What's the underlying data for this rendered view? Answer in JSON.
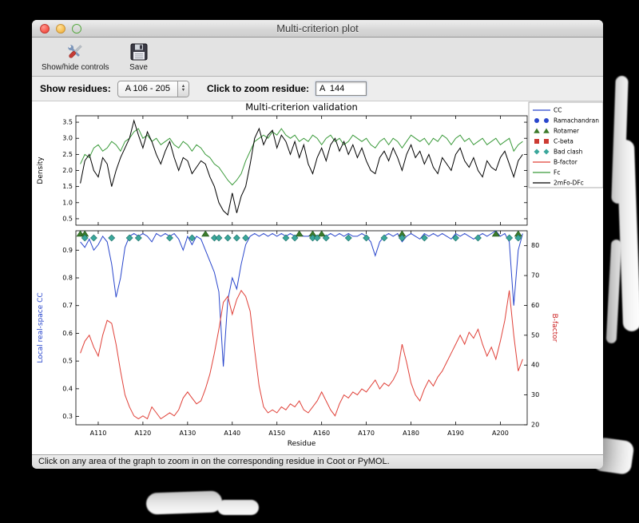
{
  "window": {
    "title": "Multi-criterion plot"
  },
  "toolbar": {
    "show_hide_label": "Show/hide controls",
    "save_label": "Save"
  },
  "controls": {
    "show_residues_label": "Show residues:",
    "residue_range_value": "A 106 - 205",
    "zoom_residue_label": "Click to zoom residue:",
    "zoom_residue_value": "A  144"
  },
  "status": {
    "text": "Click on any area of the graph to zoom in on the corresponding residue in Coot or PyMOL."
  },
  "chart_data": {
    "type": "line",
    "title": "Multi-criterion validation",
    "xlabel": "Residue",
    "x_start": 106,
    "xlim": [
      105,
      206
    ],
    "xticks": [
      110,
      120,
      130,
      140,
      150,
      160,
      170,
      180,
      190,
      200
    ],
    "xtick_labels": [
      "A110",
      "A120",
      "A130",
      "A140",
      "A150",
      "A160",
      "A170",
      "A180",
      "A190",
      "A200"
    ],
    "legend": [
      {
        "label": "CC",
        "type": "line",
        "color": "#2946cc"
      },
      {
        "label": "Ramachandran",
        "type": "circles",
        "color": "#2946cc"
      },
      {
        "label": "Rotamer",
        "type": "triangles",
        "color": "#3b7a2a"
      },
      {
        "label": "C-beta",
        "type": "squares",
        "color": "#cc3b33"
      },
      {
        "label": "Bad clash",
        "type": "diamonds",
        "color": "#3aa79b"
      },
      {
        "label": "B-factor",
        "type": "line",
        "color": "#e04038"
      },
      {
        "label": "Fc",
        "type": "line",
        "color": "#3a9a3a"
      },
      {
        "label": "2mFo-DFc",
        "type": "line",
        "color": "#000000"
      }
    ],
    "top": {
      "ylabel": "Density",
      "ylim": [
        0.3,
        3.7
      ],
      "yticks": [
        0.5,
        1.0,
        1.5,
        2.0,
        2.5,
        3.0,
        3.5
      ],
      "series": [
        {
          "name": "Fc",
          "color": "#3a9a3a",
          "values": [
            2.2,
            2.5,
            2.4,
            2.7,
            2.8,
            2.6,
            2.7,
            2.9,
            2.8,
            2.6,
            2.9,
            3.0,
            3.2,
            3.3,
            3.0,
            3.1,
            2.9,
            3.0,
            2.8,
            2.9,
            3.0,
            2.8,
            2.7,
            2.9,
            2.8,
            2.6,
            2.8,
            2.7,
            2.5,
            2.4,
            2.2,
            2.1,
            1.9,
            1.7,
            1.55,
            1.7,
            1.9,
            2.3,
            2.6,
            2.9,
            3.0,
            3.1,
            3.0,
            3.2,
            3.1,
            3.3,
            3.1,
            3.0,
            3.1,
            2.9,
            3.0,
            2.9,
            3.1,
            3.0,
            2.8,
            3.0,
            3.1,
            2.9,
            3.0,
            2.8,
            2.9,
            3.1,
            3.0,
            2.9,
            3.0,
            2.8,
            2.7,
            2.9,
            3.0,
            2.8,
            3.0,
            2.9,
            2.7,
            2.9,
            3.1,
            3.0,
            2.9,
            3.0,
            2.8,
            3.0,
            2.9,
            3.1,
            3.0,
            2.8,
            3.0,
            3.1,
            2.9,
            3.0,
            2.8,
            2.9,
            3.0,
            2.8,
            2.9,
            3.0,
            2.8,
            2.9,
            3.0,
            2.6,
            2.8,
            2.9
          ]
        },
        {
          "name": "2mFo-DFc",
          "color": "#000000",
          "values": [
            1.6,
            2.3,
            2.5,
            2.0,
            1.8,
            2.4,
            2.2,
            1.5,
            2.0,
            2.4,
            2.7,
            3.0,
            3.55,
            3.1,
            2.7,
            3.2,
            2.9,
            2.5,
            2.2,
            2.6,
            2.9,
            2.4,
            2.0,
            2.4,
            2.3,
            1.9,
            2.1,
            2.3,
            2.2,
            1.8,
            1.5,
            1.0,
            0.75,
            0.62,
            1.3,
            0.68,
            1.2,
            1.5,
            2.2,
            3.0,
            3.3,
            2.8,
            3.1,
            3.25,
            2.7,
            3.1,
            2.9,
            2.5,
            2.9,
            2.4,
            2.8,
            2.2,
            1.9,
            2.4,
            2.7,
            2.3,
            2.8,
            3.0,
            2.6,
            2.9,
            2.5,
            2.8,
            2.4,
            2.7,
            2.3,
            2.0,
            1.9,
            2.4,
            2.6,
            2.3,
            2.7,
            2.4,
            2.0,
            2.5,
            2.8,
            2.4,
            2.6,
            2.2,
            2.5,
            2.1,
            1.9,
            2.4,
            2.2,
            2.0,
            2.5,
            2.7,
            2.3,
            2.1,
            2.4,
            2.0,
            1.8,
            2.3,
            2.1,
            2.0,
            2.4,
            2.6,
            2.2,
            1.8,
            2.3,
            2.5
          ]
        }
      ]
    },
    "bottom": {
      "ylabel_left": "Local real-space CC",
      "ylabel_left_color": "#2946cc",
      "ylim_left": [
        0.27,
        0.97
      ],
      "yticks_left": [
        0.3,
        0.4,
        0.5,
        0.6,
        0.7,
        0.8,
        0.9
      ],
      "ylabel_right": "B-factor",
      "ylabel_right_color": "#cc2222",
      "ylim_right": [
        20,
        85
      ],
      "yticks_right": [
        20,
        30,
        40,
        50,
        60,
        70,
        80
      ],
      "series": [
        {
          "name": "CC",
          "axis": "left",
          "color": "#2946cc",
          "values": [
            0.93,
            0.91,
            0.94,
            0.9,
            0.92,
            0.95,
            0.93,
            0.85,
            0.73,
            0.8,
            0.91,
            0.95,
            0.96,
            0.95,
            0.96,
            0.95,
            0.93,
            0.96,
            0.95,
            0.96,
            0.95,
            0.96,
            0.94,
            0.9,
            0.95,
            0.92,
            0.95,
            0.94,
            0.9,
            0.86,
            0.82,
            0.75,
            0.48,
            0.72,
            0.8,
            0.76,
            0.85,
            0.92,
            0.95,
            0.96,
            0.95,
            0.96,
            0.95,
            0.96,
            0.95,
            0.96,
            0.95,
            0.96,
            0.95,
            0.96,
            0.95,
            0.95,
            0.96,
            0.95,
            0.96,
            0.95,
            0.96,
            0.95,
            0.96,
            0.95,
            0.96,
            0.95,
            0.95,
            0.96,
            0.95,
            0.93,
            0.88,
            0.93,
            0.95,
            0.96,
            0.95,
            0.96,
            0.93,
            0.95,
            0.96,
            0.95,
            0.94,
            0.96,
            0.95,
            0.96,
            0.95,
            0.96,
            0.95,
            0.94,
            0.96,
            0.95,
            0.96,
            0.95,
            0.94,
            0.95,
            0.96,
            0.95,
            0.96,
            0.97,
            0.95,
            0.96,
            0.93,
            0.7,
            0.9,
            0.96
          ]
        },
        {
          "name": "B-factor",
          "axis": "right",
          "color": "#e04038",
          "values": [
            44,
            48,
            50,
            46,
            43,
            50,
            55,
            54,
            47,
            38,
            30,
            26,
            23,
            22,
            23,
            22,
            26,
            24,
            22,
            23,
            24,
            23,
            25,
            29,
            31,
            29,
            27,
            28,
            32,
            37,
            44,
            52,
            61,
            63,
            57,
            62,
            65,
            63,
            58,
            45,
            33,
            26,
            24,
            25,
            24,
            26,
            25,
            27,
            26,
            28,
            25,
            24,
            26,
            28,
            31,
            28,
            25,
            23,
            27,
            30,
            29,
            31,
            30,
            32,
            31,
            33,
            35,
            32,
            34,
            33,
            35,
            38,
            47,
            41,
            34,
            30,
            28,
            32,
            35,
            33,
            36,
            38,
            41,
            44,
            47,
            50,
            47,
            51,
            49,
            52,
            47,
            43,
            46,
            42,
            48,
            55,
            65,
            50,
            38,
            42
          ]
        }
      ],
      "markers": [
        {
          "name": "Ramachandran",
          "shape": "circle",
          "color": "#2946cc",
          "residues": []
        },
        {
          "name": "Rotamer",
          "shape": "triangle",
          "color": "#3b7a2a",
          "residues": [
            106,
            107,
            134,
            155,
            158,
            160,
            178,
            199,
            204
          ]
        },
        {
          "name": "C-beta",
          "shape": "square",
          "color": "#cc3b33",
          "residues": []
        },
        {
          "name": "Bad clash",
          "shape": "diamond",
          "color": "#3aa79b",
          "residues": [
            107,
            109,
            113,
            117,
            119,
            126,
            131,
            136,
            137,
            139,
            141,
            143,
            152,
            154,
            158,
            159,
            161,
            166,
            170,
            174,
            178,
            183,
            190,
            195,
            202,
            204
          ]
        }
      ]
    }
  }
}
